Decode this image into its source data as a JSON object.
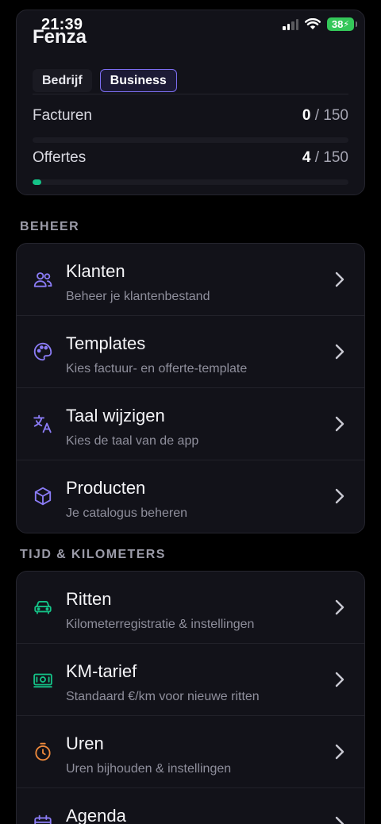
{
  "status_bar": {
    "time": "21:39",
    "battery": "38"
  },
  "account": {
    "company": "Fenza",
    "chips": [
      "Bedrijf",
      "Business"
    ],
    "usage": [
      {
        "label": "Facturen",
        "used": "0",
        "total": "/ 150",
        "fraction": 0.0
      },
      {
        "label": "Offertes",
        "used": "4",
        "total": "/ 150",
        "fraction": 0.027
      }
    ]
  },
  "sections": [
    {
      "title": "BEHEER",
      "items": [
        {
          "icon": "users-icon",
          "title": "Klanten",
          "subtitle": "Beheer je klantenbestand"
        },
        {
          "icon": "palette-icon",
          "title": "Templates",
          "subtitle": "Kies factuur- en offerte-template"
        },
        {
          "icon": "translate-icon",
          "title": "Taal wijzigen",
          "subtitle": "Kies de taal van de app"
        },
        {
          "icon": "box-icon",
          "title": "Producten",
          "subtitle": "Je catalogus beheren"
        }
      ]
    },
    {
      "title": "TIJD & KILOMETERS",
      "items": [
        {
          "icon": "car-icon",
          "title": "Ritten",
          "subtitle": "Kilometerregistratie & instellingen"
        },
        {
          "icon": "banknote-icon",
          "title": "KM-tarief",
          "subtitle": "Standaard €/km voor nieuwe ritten"
        },
        {
          "icon": "timer-icon",
          "title": "Uren",
          "subtitle": "Uren bijhouden & instellingen"
        },
        {
          "icon": "calendar-icon",
          "title": "Agenda",
          "subtitle": ""
        }
      ]
    }
  ],
  "colors": {
    "accent_purple": "#8b7cf6",
    "accent_green": "#14c287",
    "accent_orange": "#f08a3c",
    "background": "#000000",
    "card": "#121219"
  }
}
